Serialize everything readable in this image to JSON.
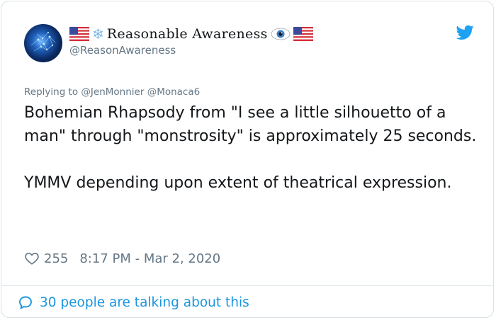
{
  "tweet": {
    "display_name": "Reasonable Awareness",
    "handle": "@ReasonAwareness",
    "replying_prefix": "Replying to",
    "reply_mentions": [
      "@JenMonnier",
      "@Monaca6"
    ],
    "paragraphs": [
      "Bohemian Rhapsody from \"I see a little silhouetto of a man\" through \"monstrosity\" is approximately 25 seconds.",
      "YMMV depending upon extent of theatrical expression."
    ],
    "likes": "255",
    "timestamp": "8:17 PM - Mar 2, 2020",
    "talking": "30 people are talking about this"
  },
  "icons": {
    "flag": "us-flag-icon",
    "snowflake": "snowflake-icon",
    "eye": "eye-icon",
    "brand": "twitter-bird-icon",
    "like": "heart-icon",
    "conversation": "speech-bubble-icon"
  },
  "colors": {
    "accent": "#1b95e0",
    "muted": "#657786",
    "text": "#14171a",
    "border": "#d9e1e6",
    "twitter_blue": "#1da1f2"
  }
}
